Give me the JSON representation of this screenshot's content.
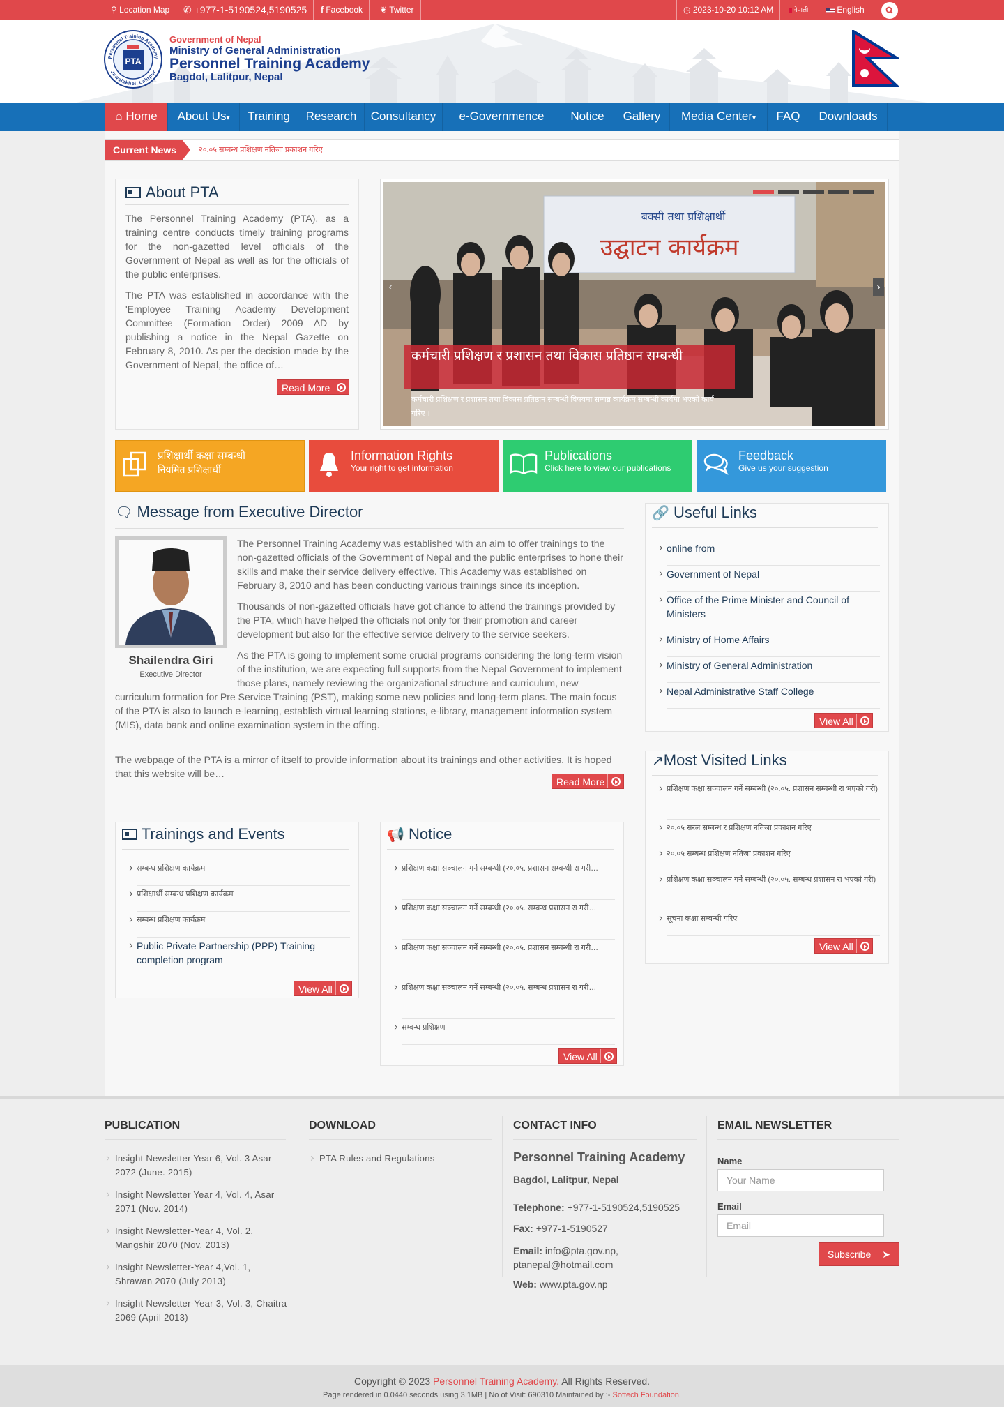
{
  "topbar": {
    "location": "Location Map",
    "phone": "+977-1-5190524,5190525",
    "facebook": "Facebook",
    "twitter": "Twitter",
    "datetime": "2023-10-20 10:12 AM",
    "lang_nepali": "नेपाली",
    "lang_english": "English"
  },
  "header": {
    "line1": "Government of Nepal",
    "line2": "Ministry of General Administration",
    "line3": "Personnel Training Academy",
    "line4": "Bagdol, Lalitpur, Nepal",
    "seal_top": "Personnel Training Academy",
    "seal_bottom": "Jawalakhel, Lalitpur",
    "seal_mark": "PTA"
  },
  "nav": [
    "Home",
    "About Us",
    "Training",
    "Research",
    "Consultancy",
    "e-Governmence",
    "Notice",
    "Gallery",
    "Media Center",
    "FAQ",
    "Downloads"
  ],
  "ticker": {
    "label": "Current News",
    "text": "२०.०५ सम्बन्ध प्रशिक्षण नतिजा प्रकाशन गरिए"
  },
  "about": {
    "title": "About PTA",
    "p1": "The Personnel Training Academy (PTA), as a training centre conducts timely training programs for the non-gazetted level officials of the Government of Nepal as well as for the officials of the public enterprises.",
    "p2": "The PTA was established in accordance with the 'Employee Training Academy Development Committee (Formation Order) 2009 AD by publishing a notice in the Nepal Gazette on February 8, 2010. As per the decision made by the Government of Nepal, the office of…",
    "read_more": "Read More"
  },
  "slider": {
    "caption_title": "कर्मचारी प्रशिक्षण र प्रशासन तथा विकास प्रतिष्ठान सम्बन्धी",
    "caption_text": "कर्मचारी प्रशिक्षण र प्रशासन तथा विकास प्रतिष्ठान सम्बन्धी विषयमा सम्पन्न कार्यक्रम सम्बन्धी कार्यमा भएको कार्य गरिए ।",
    "banner_text": "उद्घाटन कार्यक्रम",
    "banner_small": "बक्सी तथा प्रशिक्षार्थी",
    "active_dot": 0,
    "dot_count": 5
  },
  "tiles": [
    {
      "title": "प्रशिक्षार्थी कक्षा सम्बन्धी",
      "sub": "नियमित प्रशिक्षार्थी",
      "color": "#f5a623"
    },
    {
      "title": "Information Rights",
      "sub": "Your right to get information",
      "color": "#e84c3d"
    },
    {
      "title": "Publications",
      "sub": "Click here to view our publications",
      "color": "#2ecc71"
    },
    {
      "title": "Feedback",
      "sub": "Give us your suggestion",
      "color": "#3498db"
    }
  ],
  "message": {
    "title": "Message from Executive Director",
    "name": "Shailendra Giri",
    "role": "Executive Director",
    "p1": "The Personnel Training Academy was established with an aim to offer trainings to the non-gazetted officials of the Government of Nepal and the public enterprises to hone their skills and make their service delivery effective. This Academy was established on February 8, 2010 and has been conducting various trainings since its inception.",
    "p2": "Thousands of non-gazetted officials have got chance to attend the trainings provided by the PTA, which have helped the officials not only for their promotion and career development but also for the effective service delivery to the service seekers.",
    "p3a": "As the PTA is going to implement some crucial programs considering the long-term vision of the institution, we are expecting full supports from the Nepal Government to implement those plans, namely reviewing the organizational structure and curriculum, new",
    "p3b": "curriculum formation for Pre Service Training (PST), making some new policies and long-term plans. The main focus of the PTA is also to launch e-learning, establish virtual learning stations, e-library, management information system (MIS), data bank and online examination system in the offing.",
    "p4": "The webpage of the PTA is a mirror of itself to provide information about its trainings and other activities. It is hoped that this website will be…",
    "read_more": "Read More"
  },
  "useful_links": {
    "title": "Useful Links",
    "items": [
      "online from",
      "Government of Nepal",
      "Office of the Prime Minister and Council of Ministers",
      "Ministry of Home Affairs",
      "Ministry of General Administration",
      "Nepal Administrative Staff College"
    ],
    "view_all": "View All"
  },
  "most_visited": {
    "title": "Most Visited Links",
    "items": [
      "प्रशिक्षण कक्षा सञ्चालन गर्ने सम्बन्धी (२०.०५. प्रशासन सम्बन्धी रा भएको गरी)",
      "२०.०५ सरल सम्बन्ध र प्रशिक्षण नतिजा प्रकाशन गरिए",
      "२०.०५ सम्बन्ध प्रशिक्षण नतिजा प्रकाशन गरिए",
      "प्रशिक्षण कक्षा सञ्चालन गर्ने सम्बन्धी (२०.०५. सम्बन्ध प्रशासन रा भएको गरी)",
      "सूचना कक्षा सम्बन्धी गरिए"
    ],
    "view_all": "View All"
  },
  "trainings": {
    "title": "Trainings and Events",
    "items": [
      "सम्बन्ध प्रशिक्षण कार्यक्रम",
      "प्रशिक्षार्थी सम्बन्ध प्रशिक्षण कार्यक्रम",
      "सम्बन्ध प्रशिक्षण कार्यक्रम",
      "Public Private Partnership (PPP) Training completion program"
    ],
    "view_all": "View All"
  },
  "notice": {
    "title": "Notice",
    "items": [
      "प्रशिक्षण कक्षा सञ्चालन गर्ने सम्बन्धी (२०.०५. प्रशासन सम्बन्धी रा गरी…",
      "प्रशिक्षण कक्षा सञ्चालन गर्ने सम्बन्धी (२०.०५. सम्बन्ध प्रशासन रा गरी…",
      "प्रशिक्षण कक्षा सञ्चालन गर्ने सम्बन्धी (२०.०५. प्रशासन सम्बन्धी रा गरी…",
      "प्रशिक्षण कक्षा सञ्चालन गर्ने सम्बन्धी (२०.०५. सम्बन्ध प्रशासन रा गरी…",
      "सम्बन्ध प्रशिक्षण"
    ],
    "view_all": "View All"
  },
  "footer": {
    "publication": {
      "title": "PUBLICATION",
      "items": [
        "Insight Newsletter Year 6, Vol. 3 Asar 2072 (June. 2015)",
        "Insight Newsletter Year 4, Vol. 4, Asar 2071 (Nov. 2014)",
        "Insight Newsletter-Year 4, Vol. 2, Mangshir 2070 (Nov. 2013)",
        "Insight Newsletter-Year 4,Vol. 1, Shrawan 2070 (July 2013)",
        "Insight Newsletter-Year 3, Vol. 3, Chaitra 2069 (April 2013)"
      ]
    },
    "download": {
      "title": "DOWNLOAD",
      "items": [
        "PTA Rules and Regulations"
      ]
    },
    "contact": {
      "title": "CONTACT INFO",
      "org": "Personnel Training Academy",
      "address": "Bagdol, Lalitpur, Nepal",
      "tel_label": "Telephone:",
      "tel": "+977-1-5190524,5190525",
      "fax_label": "Fax:",
      "fax": "+977-1-5190527",
      "email_label": "Email:",
      "email": "info@pta.gov.np, ptanepal@hotmail.com",
      "web_label": "Web:",
      "web": "www.pta.gov.np"
    },
    "newsletter": {
      "title": "EMAIL NEWSLETTER",
      "name_label": "Name",
      "name_placeholder": "Your Name",
      "email_label": "Email",
      "email_placeholder": "Email",
      "subscribe": "Subscribe"
    }
  },
  "copyright": {
    "prefix": "Copyright © 2023",
    "org": "Personnel Training Academy.",
    "suffix": "All Rights Reserved.",
    "rendered": "Page rendered in 0.0440 seconds using 3.1MB | No of Visit: 690310 Maintained by :-",
    "maintainer": "Softech Foundation."
  },
  "colors": {
    "brand_red": "#e0484b",
    "nav_blue": "#1770b8",
    "heading": "#1f3b57"
  }
}
